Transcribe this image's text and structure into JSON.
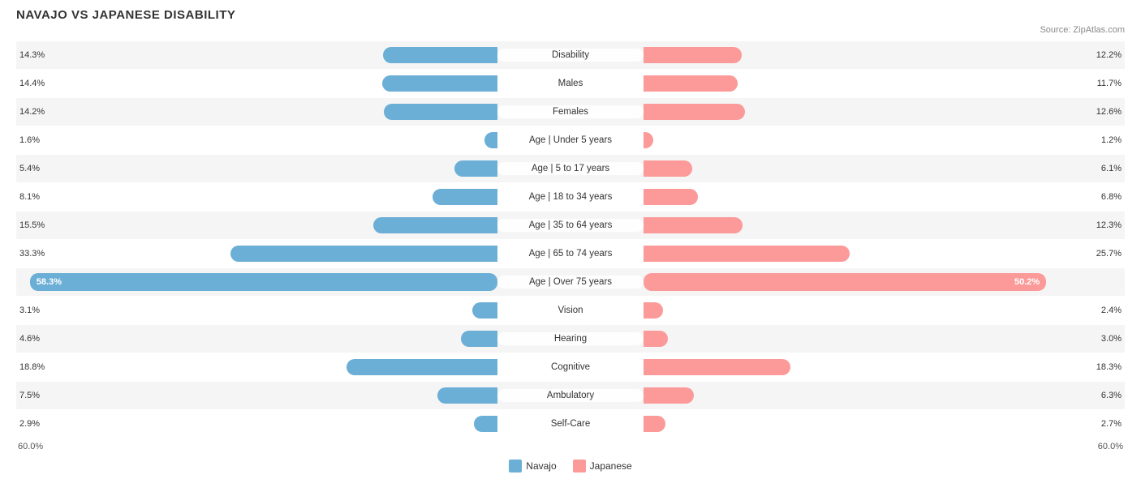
{
  "title": "NAVAJO VS JAPANESE DISABILITY",
  "source": "Source: ZipAtlas.com",
  "axis": {
    "left": "60.0%",
    "right": "60.0%"
  },
  "legend": {
    "navajo_label": "Navajo",
    "japanese_label": "Japanese",
    "navajo_color": "#6baed6",
    "japanese_color": "#fb9a99"
  },
  "rows": [
    {
      "label": "Disability",
      "navajo": 14.3,
      "japanese": 12.2,
      "navajo_pct": "14.3%",
      "japanese_pct": "12.2%"
    },
    {
      "label": "Males",
      "navajo": 14.4,
      "japanese": 11.7,
      "navajo_pct": "14.4%",
      "japanese_pct": "11.7%"
    },
    {
      "label": "Females",
      "navajo": 14.2,
      "japanese": 12.6,
      "navajo_pct": "14.2%",
      "japanese_pct": "12.6%"
    },
    {
      "label": "Age | Under 5 years",
      "navajo": 1.6,
      "japanese": 1.2,
      "navajo_pct": "1.6%",
      "japanese_pct": "1.2%"
    },
    {
      "label": "Age | 5 to 17 years",
      "navajo": 5.4,
      "japanese": 6.1,
      "navajo_pct": "5.4%",
      "japanese_pct": "6.1%"
    },
    {
      "label": "Age | 18 to 34 years",
      "navajo": 8.1,
      "japanese": 6.8,
      "navajo_pct": "8.1%",
      "japanese_pct": "6.8%"
    },
    {
      "label": "Age | 35 to 64 years",
      "navajo": 15.5,
      "japanese": 12.3,
      "navajo_pct": "15.5%",
      "japanese_pct": "12.3%"
    },
    {
      "label": "Age | 65 to 74 years",
      "navajo": 33.3,
      "japanese": 25.7,
      "navajo_pct": "33.3%",
      "japanese_pct": "25.7%"
    },
    {
      "label": "Age | Over 75 years",
      "navajo": 58.3,
      "japanese": 50.2,
      "navajo_pct": "58.3%",
      "japanese_pct": "50.2%",
      "special": true
    },
    {
      "label": "Vision",
      "navajo": 3.1,
      "japanese": 2.4,
      "navajo_pct": "3.1%",
      "japanese_pct": "2.4%"
    },
    {
      "label": "Hearing",
      "navajo": 4.6,
      "japanese": 3.0,
      "navajo_pct": "4.6%",
      "japanese_pct": "3.0%"
    },
    {
      "label": "Cognitive",
      "navajo": 18.8,
      "japanese": 18.3,
      "navajo_pct": "18.8%",
      "japanese_pct": "18.3%"
    },
    {
      "label": "Ambulatory",
      "navajo": 7.5,
      "japanese": 6.3,
      "navajo_pct": "7.5%",
      "japanese_pct": "6.3%"
    },
    {
      "label": "Self-Care",
      "navajo": 2.9,
      "japanese": 2.7,
      "navajo_pct": "2.9%",
      "japanese_pct": "2.7%"
    }
  ],
  "max_val": 60
}
